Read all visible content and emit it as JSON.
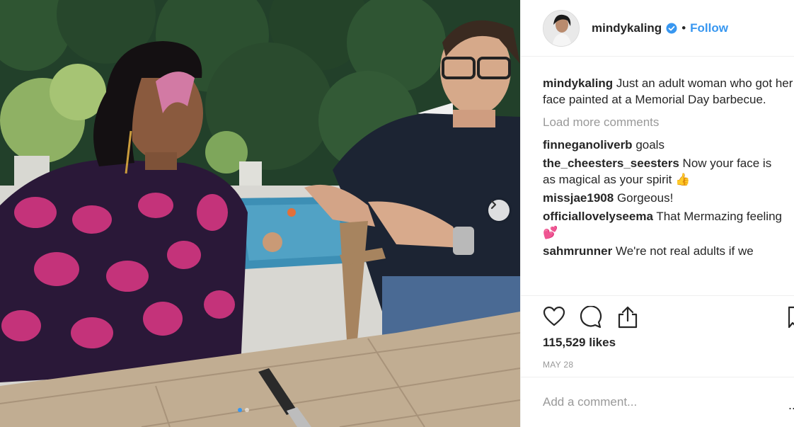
{
  "post": {
    "username": "mindykaling",
    "separator": "•",
    "follow_label": "Follow",
    "caption_user": "mindykaling",
    "caption_text": "Just an adult woman who got her face painted at a Memorial Day barbecue.",
    "load_more_label": "Load more comments",
    "likes": "115,529 likes",
    "date": "MAY 28",
    "comment_placeholder": "Add a comment...",
    "more_label": "..."
  },
  "comments": [
    {
      "user": "finneganoliverb",
      "text": "goals",
      "emoji": ""
    },
    {
      "user": "the_cheesters_seesters",
      "text": "Now your face is as magical as your spirit",
      "emoji": "👍"
    },
    {
      "user": "missjae1908",
      "text": "Gorgeous!",
      "emoji": ""
    },
    {
      "user": "officiallovelyseema",
      "text": "That Mermazing feeling",
      "emoji": "💕"
    },
    {
      "user": "sahmrunner",
      "text": "We're not real adults if we",
      "emoji": ""
    }
  ],
  "carousel": {
    "total": 2,
    "active": 1
  },
  "colors": {
    "accent": "#3897f0",
    "secondary_text": "#999999",
    "border": "#efefef"
  },
  "icons": [
    "verified-badge-icon",
    "heart-icon",
    "comment-icon",
    "share-icon",
    "bookmark-icon",
    "chevron-right-icon"
  ]
}
